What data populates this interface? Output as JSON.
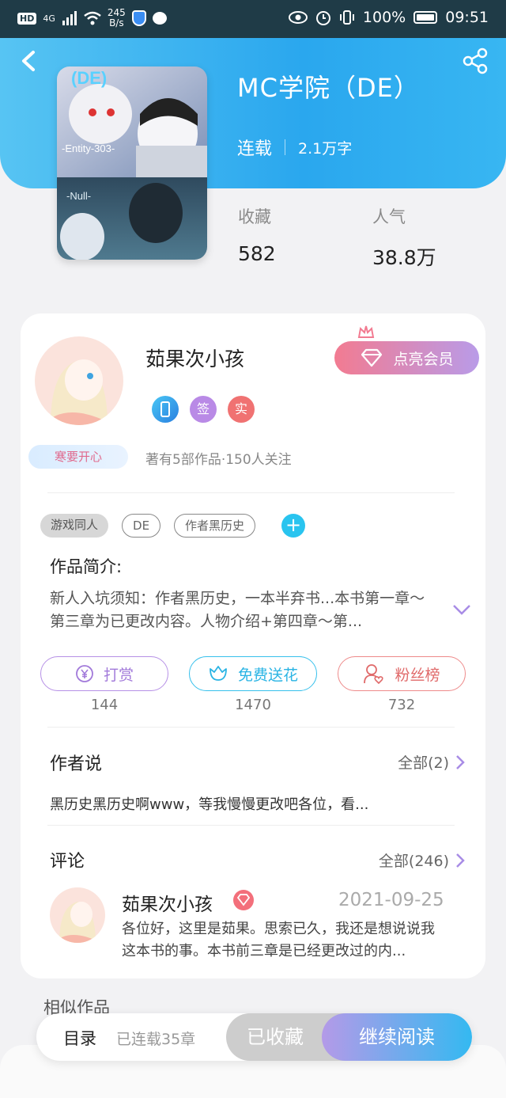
{
  "status_bar": {
    "hd_label": "HD",
    "network_label": "4G",
    "speed_value": "245",
    "speed_unit": "B/s",
    "battery_text": "100%",
    "time": "09:51"
  },
  "book": {
    "title": "MC学院（DE）",
    "status": "连载",
    "word_count": "2.1万字",
    "favorites_label": "收藏",
    "favorites_value": "582",
    "popularity_label": "人气",
    "popularity_value": "38.8万",
    "cover_text_top": "(DE)",
    "cover_text_entity": "-Entity-303-",
    "cover_text_null": "-Null-"
  },
  "author": {
    "name": "茹果次小孩",
    "pendant_text": "寒要开心",
    "badges": [
      "签",
      "实"
    ],
    "subtitle": "著有5部作品·150人关注",
    "vip_button": "点亮会员"
  },
  "tags": [
    "游戏同人",
    "DE",
    "作者黑历史"
  ],
  "intro": {
    "heading": "作品简介:",
    "text": "新人入坑须知：作者黑历史，一本半弃书...本书第一章～第三章为已更改内容。人物介绍+第四章～第..."
  },
  "actions": [
    {
      "label": "打赏",
      "count": "144"
    },
    {
      "label": "免费送花",
      "count": "1470"
    },
    {
      "label": "粉丝榜",
      "count": "732"
    }
  ],
  "author_says": {
    "heading": "作者说",
    "more": "全部(2)",
    "text": "黑历史黑历史啊www，等我慢慢更改吧各位，看..."
  },
  "comments": {
    "heading": "评论",
    "more": "全部(246)",
    "item": {
      "name": "茹果次小孩",
      "date": "2021-09-25",
      "text": "各位好，这里是茹果。思索已久，我还是想说说我这本书的事。本书前三章是已经更改过的内..."
    }
  },
  "similar_heading": "相似作品",
  "bottom_bar": {
    "catalog": "目录",
    "chapters": "已连载35章",
    "saved": "已收藏",
    "continue": "继续阅读"
  },
  "colors": {
    "header_blue": "#2aa7ee",
    "vip_pink": "#f27b91",
    "tag_blue": "#29c4ef",
    "reward_purple": "#b07ae0",
    "flower_cyan": "#36c0ec",
    "fans_red": "#e06a6a"
  },
  "icons": [
    "back-arrow-icon",
    "share-icon",
    "phone-badge-icon",
    "diamond-icon",
    "crown-icon",
    "yen-icon",
    "flower-icon",
    "person-heart-icon",
    "chevron-down-icon",
    "chevron-right-icon"
  ]
}
